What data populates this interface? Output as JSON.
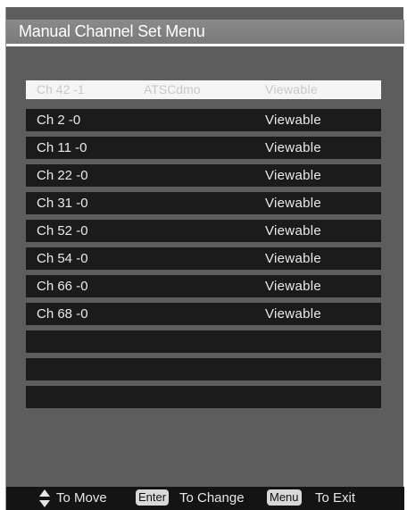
{
  "title": "Manual Channel Set Menu",
  "selected": {
    "channel": "Ch 42 -1",
    "type": "ATSCdmo",
    "status": "Viewable"
  },
  "rows": [
    {
      "channel": "Ch 2 -0",
      "status": "Viewable"
    },
    {
      "channel": "Ch 11 -0",
      "status": "Viewable"
    },
    {
      "channel": "Ch 22 -0",
      "status": "Viewable"
    },
    {
      "channel": "Ch 31 -0",
      "status": "Viewable"
    },
    {
      "channel": "Ch 52 -0",
      "status": "Viewable"
    },
    {
      "channel": "Ch 54 -0",
      "status": "Viewable"
    },
    {
      "channel": "Ch 66 -0",
      "status": "Viewable"
    },
    {
      "channel": "Ch 68 -0",
      "status": "Viewable"
    },
    {
      "channel": "",
      "status": ""
    },
    {
      "channel": "",
      "status": ""
    },
    {
      "channel": "",
      "status": ""
    }
  ],
  "footer": {
    "move_icon": "up-down-arrow-icon",
    "move_label": "To Move",
    "enter_key": "Enter",
    "change_label": "To Change",
    "menu_key": "Menu",
    "exit_label": "To Exit"
  }
}
